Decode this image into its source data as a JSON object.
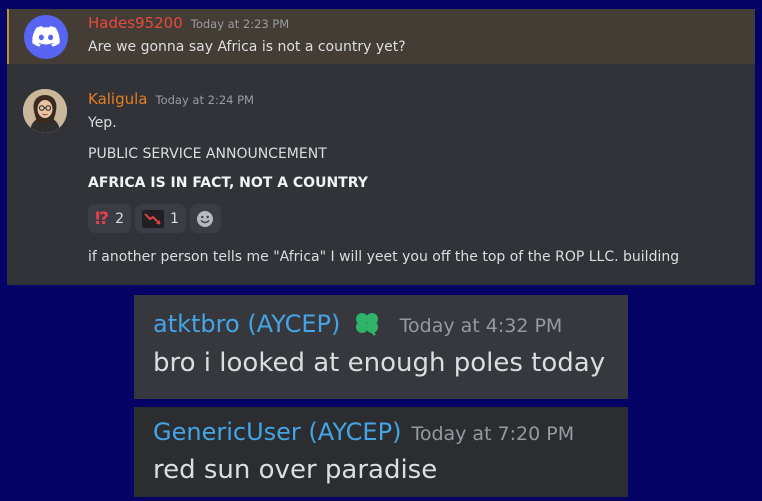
{
  "messages": [
    {
      "author": "Hades95200",
      "timestamp": "Today at 2:23 PM",
      "lines": [
        "Are we gonna say Africa is not a country yet?"
      ],
      "author_color": "#e9483f",
      "avatar_icon": "discord-logo-icon"
    },
    {
      "author": "Kaligula",
      "timestamp": "Today at 2:24 PM",
      "lines": [
        "Yep.",
        "PUBLIC SERVICE ANNOUNCEMENT",
        "AFRICA IS IN FACT, NOT A COUNTRY",
        "if another person tells me \"Africa\" I will yeet you off the top of the ROP LLC. building"
      ],
      "author_color": "#e67e22",
      "avatar_icon": "person-avatar-icon",
      "reactions": [
        {
          "icon": "interrobang-icon",
          "count": "2"
        },
        {
          "icon": "not-stonks-icon",
          "count": "1"
        }
      ],
      "add_reaction_icon": "smiley-icon"
    }
  ],
  "cards": [
    {
      "author": "atktbro (AYCEP)",
      "timestamp": "Today at 4:32 PM",
      "text": "bro i looked at enough poles today",
      "badge_icon": "clover-icon"
    },
    {
      "author": "GenericUser (AYCEP)",
      "timestamp": "Today at 7:20 PM",
      "text": "red sun over paradise"
    }
  ],
  "colors": {
    "background": "#050466",
    "panel": "#313338",
    "highlight": "#443d36",
    "card_name": "#43a5e6"
  }
}
